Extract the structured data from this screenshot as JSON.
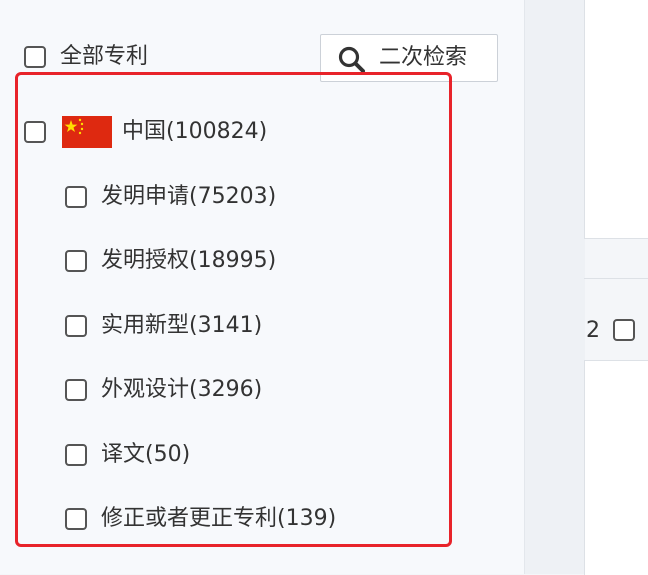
{
  "filter": {
    "all_label": "全部专利",
    "search_button_label": "二次检索",
    "country": {
      "label": "中国(100824)",
      "flag_icon": "china-flag-icon",
      "types": [
        {
          "label": "发明申请(75203)"
        },
        {
          "label": "发明授权(18995)"
        },
        {
          "label": "实用新型(3141)"
        },
        {
          "label": "外观设计(3296)"
        },
        {
          "label": "译文(50)"
        },
        {
          "label": "修正或者更正专利(139)"
        }
      ]
    }
  },
  "results": {
    "item_number": "2"
  },
  "colors": {
    "highlight": "#e8232a",
    "flag_red": "#de2910",
    "flag_star": "#ffde00"
  }
}
